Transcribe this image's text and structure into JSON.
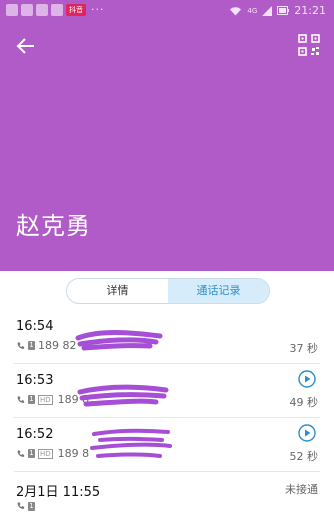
{
  "status_bar": {
    "badge": "抖音",
    "dots": "···",
    "network": "4G",
    "time": "21:21"
  },
  "contact": {
    "name": "赵克勇"
  },
  "tabs": [
    {
      "label": "详情",
      "active": false
    },
    {
      "label": "通话记录",
      "active": true
    }
  ],
  "records": [
    {
      "time": "16:54",
      "number": "189 82",
      "duration": "37 秒",
      "has_recording": false
    },
    {
      "time": "16:53",
      "number": "189 8",
      "duration": "49 秒",
      "has_recording": true
    },
    {
      "time": "16:52",
      "number": "189 8",
      "duration": "52 秒",
      "has_recording": true
    },
    {
      "time": "2月1日 11:55",
      "number": "",
      "duration": "未接通",
      "has_recording": false
    }
  ],
  "colors": {
    "header": "#b15bc8",
    "accent": "#2d8ec9",
    "redaction": "#a64fd6"
  },
  "icons": {
    "back": "back-arrow-icon",
    "qr": "qr-code-icon",
    "call": "phone-icon",
    "sim": "sim-card-icon",
    "hd": "hd-call-icon",
    "play": "play-recording-icon"
  }
}
